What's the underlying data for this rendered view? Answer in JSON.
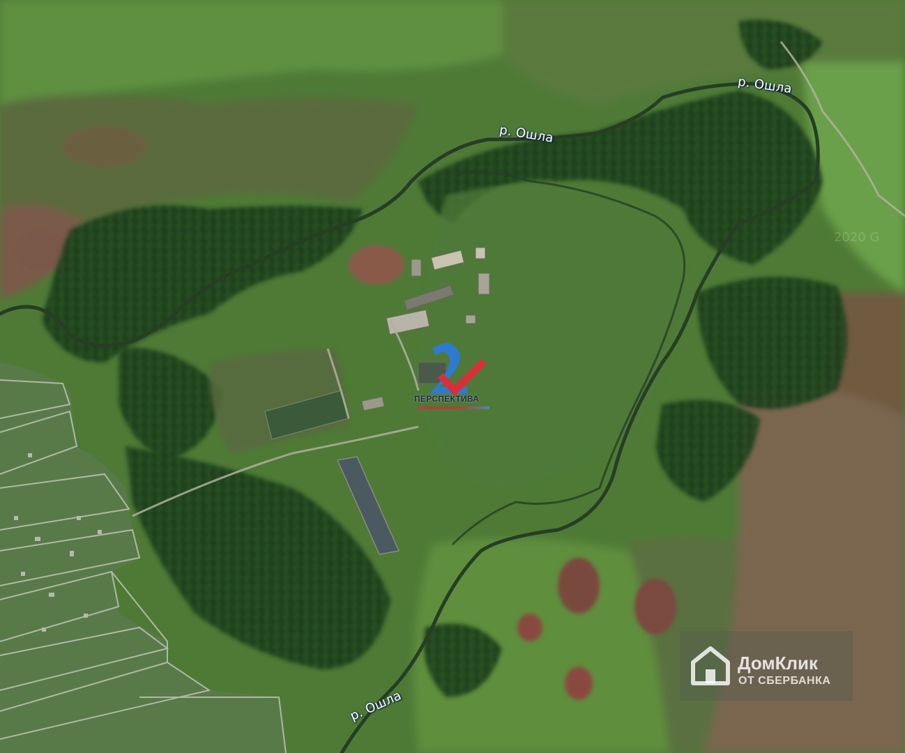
{
  "map": {
    "type": "satellite",
    "river_labels": [
      "р. Ошла",
      "р. Ошла",
      "р. Ошла"
    ],
    "corner_watermark": "2020 G",
    "colors": {
      "field": "#5b8a3a",
      "forest": "#1e3d1c",
      "meadow": "#6f9a4a",
      "river": "#2e4a2a",
      "road": "#b8b8a8",
      "bare": "#8a5a48"
    }
  },
  "overlay_logo": {
    "name": "ПЕРСПЕКТИВА",
    "icon": "perspektiva-24-logo-icon",
    "colors": {
      "blue": "#2e7ad0",
      "red": "#d8303a"
    }
  },
  "watermark": {
    "name": "ДомКлик",
    "subtitle": "ОТ СБЕРБАНКА",
    "icon": "domclick-house-icon"
  }
}
